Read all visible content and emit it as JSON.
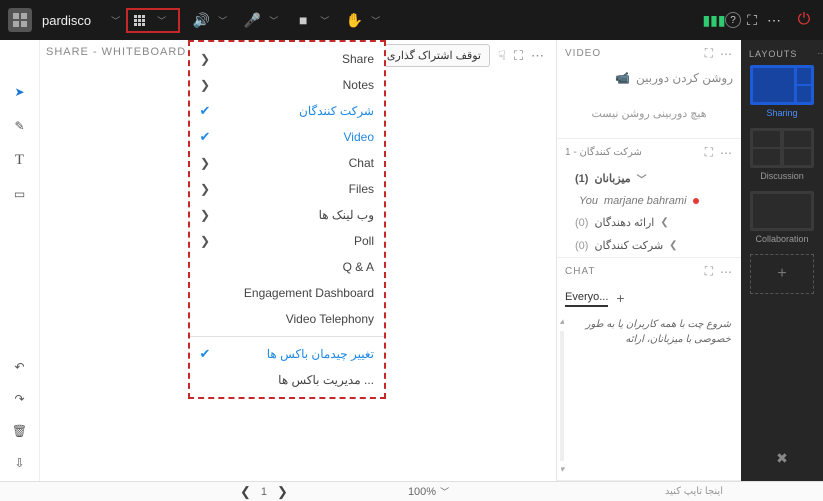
{
  "topbar": {
    "brand": "pardisco",
    "icons": {
      "grid": "grid-icon",
      "audio": "speaker-icon",
      "mic": "mic-icon",
      "cam": "camera-icon",
      "hand": "hand-icon",
      "signal": "signal-icon",
      "help": "?",
      "full": "fullscreen-icon",
      "more": "⋯",
      "power": "power-icon"
    }
  },
  "whiteboard": {
    "title": "SHARE - WHITEBOARD"
  },
  "stop_share": {
    "label": "توقف اشتراک گذاری"
  },
  "dropdown": {
    "items": [
      {
        "label": "Share",
        "icon": "arrow"
      },
      {
        "label": "Notes",
        "icon": "arrow"
      },
      {
        "label": "شرکت کنندگان",
        "icon": "check",
        "blue": true
      },
      {
        "label": "Video",
        "icon": "check",
        "blue": true
      },
      {
        "label": "Chat",
        "icon": "arrow"
      },
      {
        "label": "Files",
        "icon": "arrow"
      },
      {
        "label": "وب لینک ها",
        "icon": "arrow"
      },
      {
        "label": "Poll",
        "icon": "arrow"
      },
      {
        "label": "Q & A",
        "icon": "none"
      },
      {
        "label": "Engagement Dashboard",
        "icon": "none"
      },
      {
        "label": "Video Telephony",
        "icon": "none"
      }
    ],
    "footer": [
      {
        "label": "تغییر چیدمان باکس ها",
        "icon": "check",
        "blue": true
      },
      {
        "label": "مدیریت باکس ها ...",
        "icon": "none"
      }
    ]
  },
  "video_panel": {
    "title": "VIDEO",
    "cam_on": "روشن کردن دوربین",
    "no_cam": "هیچ دوربینی روشن نیست"
  },
  "participants_panel": {
    "title": "شرکت کنندگان - 1",
    "hosts": {
      "label": "میزبانان",
      "count": "(1)"
    },
    "user": {
      "name": "marjane bahrami",
      "you": "You"
    },
    "presenters": {
      "label": "ارائه دهندگان",
      "count": "(0)"
    },
    "participants": {
      "label": "شرکت کنندگان",
      "count": "(0)"
    }
  },
  "chat_panel": {
    "title": "CHAT",
    "tab": "Everyo...",
    "body": "شروع چت با همه کاربران یا به طور خصوصی با میزبانان، ارائه"
  },
  "layouts_panel": {
    "title": "LAYOUTS",
    "items": [
      {
        "label": "Sharing",
        "active": true
      },
      {
        "label": "Discussion",
        "active": false
      },
      {
        "label": "Collaboration",
        "active": false
      }
    ]
  },
  "statusbar": {
    "page": "1",
    "zoom": "100%",
    "hint": "اینجا تایپ کنید"
  }
}
